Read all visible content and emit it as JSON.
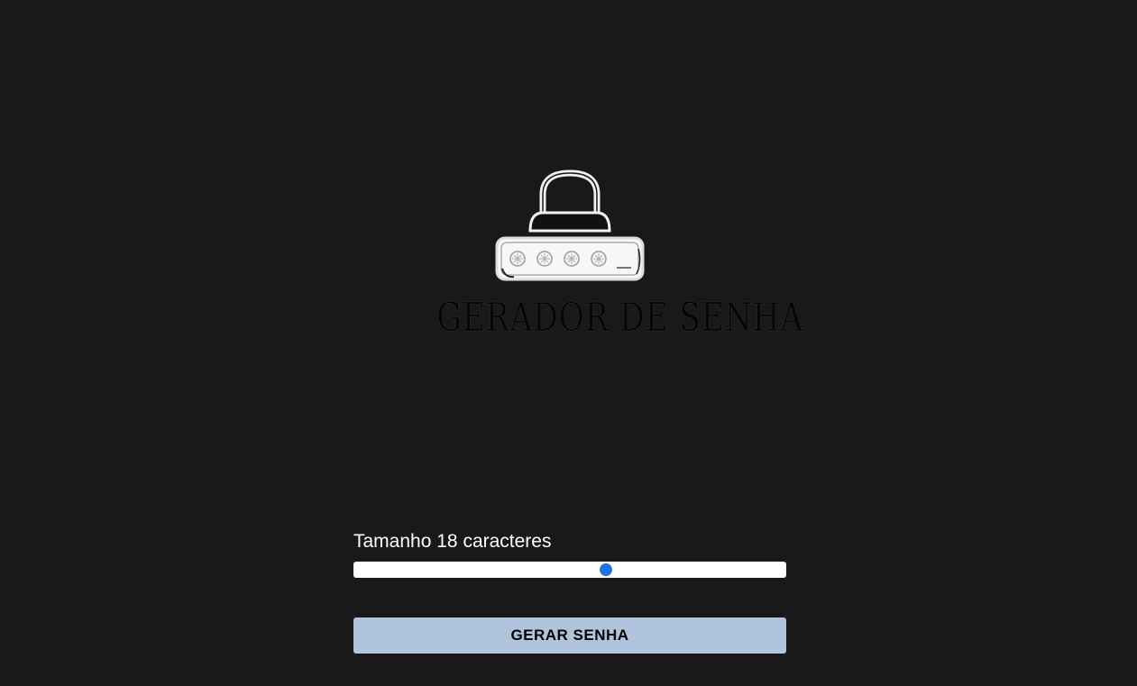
{
  "logo": {
    "icon": "padlock-password-icon",
    "title": "GERADOR DE SENHA"
  },
  "length_control": {
    "label_prefix": "Tamanho",
    "value": 18,
    "label_suffix": "caracteres",
    "min": 1,
    "max": 30
  },
  "generate_button": {
    "label": "GERAR SENHA"
  },
  "colors": {
    "background": "#191919",
    "slider_thumb": "#1a73e8",
    "button_background": "#b0c4de",
    "label_text": "#ffffff"
  }
}
